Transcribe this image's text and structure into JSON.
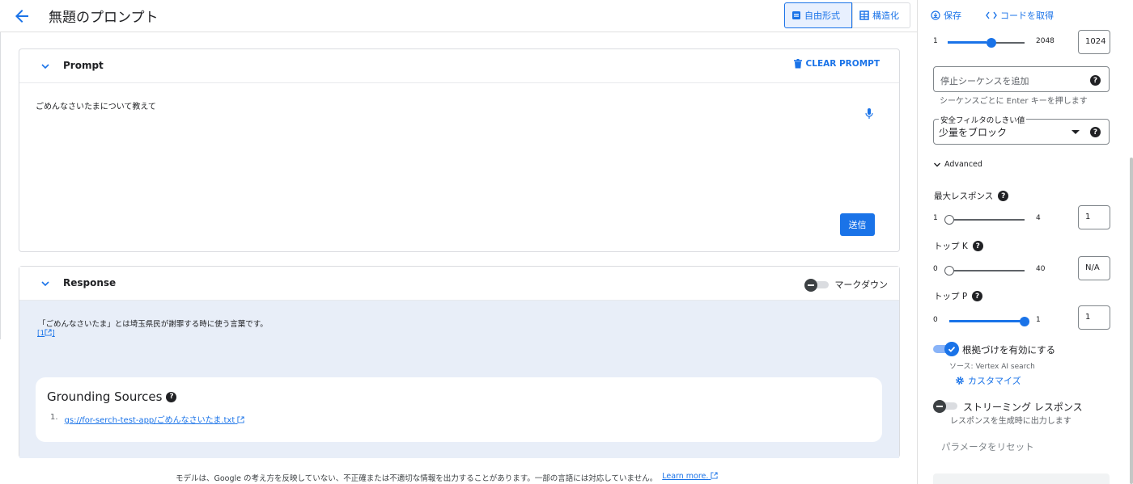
{
  "header": {
    "title": "無題のプロンプト",
    "mode_freeform": "自由形式",
    "mode_structured": "構造化"
  },
  "actions": {
    "save": "保存",
    "get_code": "コードを取得"
  },
  "prompt": {
    "section_title": "Prompt",
    "clear_label": "CLEAR PROMPT",
    "text": "ごめんなさいたまについて教えて",
    "send_label": "送信"
  },
  "response": {
    "section_title": "Response",
    "markdown_label": "マークダウン",
    "markdown_enabled": false,
    "text": "「ごめんなさいたま」とは埼玉県民が謝罪する時に使う言葉です。",
    "citation": "1",
    "grounding_title": "Grounding Sources",
    "sources": [
      {
        "index": "1.",
        "link": "gs://for-serch-test-app/ごめんなさいたま.txt"
      }
    ]
  },
  "disclaimer": {
    "text": "モデルは、Google の考え方を反映していない、不正確または不適切な情報を出力することがあります。一部の言語には対応していません。",
    "link": "Learn more."
  },
  "settings": {
    "output_tokens": {
      "min": "1",
      "max": "2048",
      "value": "1024",
      "level": 0.5
    },
    "stop_sequence_placeholder": "停止シーケンスを追加",
    "stop_sequence_hint": "シーケンスごとに Enter キーを押します",
    "safety_label": "安全フィルタのしきい値",
    "safety_value": "少量をブロック",
    "advanced_label": "Advanced",
    "max_responses": {
      "label": "最大レスポンス",
      "min": "1",
      "max": "4",
      "value": "1",
      "level": 0
    },
    "top_k": {
      "label": "トップ K",
      "min": "0",
      "max": "40",
      "value": "N/A",
      "level": 0
    },
    "top_p": {
      "label": "トップ P",
      "min": "0",
      "max": "1",
      "value": "1",
      "level": 1
    },
    "grounding": {
      "label": "根拠づけを有効にする",
      "enabled": true,
      "source": "ソース: Vertex AI search",
      "customize": "カスタマイズ"
    },
    "streaming": {
      "label": "ストリーミング レスポンス",
      "enabled": false,
      "description": "レスポンスを生成時に出力します"
    },
    "reset_label": "パラメータをリセット"
  },
  "colors": {
    "accent": "#1a73e8",
    "response_bg": "#e8eef8"
  }
}
